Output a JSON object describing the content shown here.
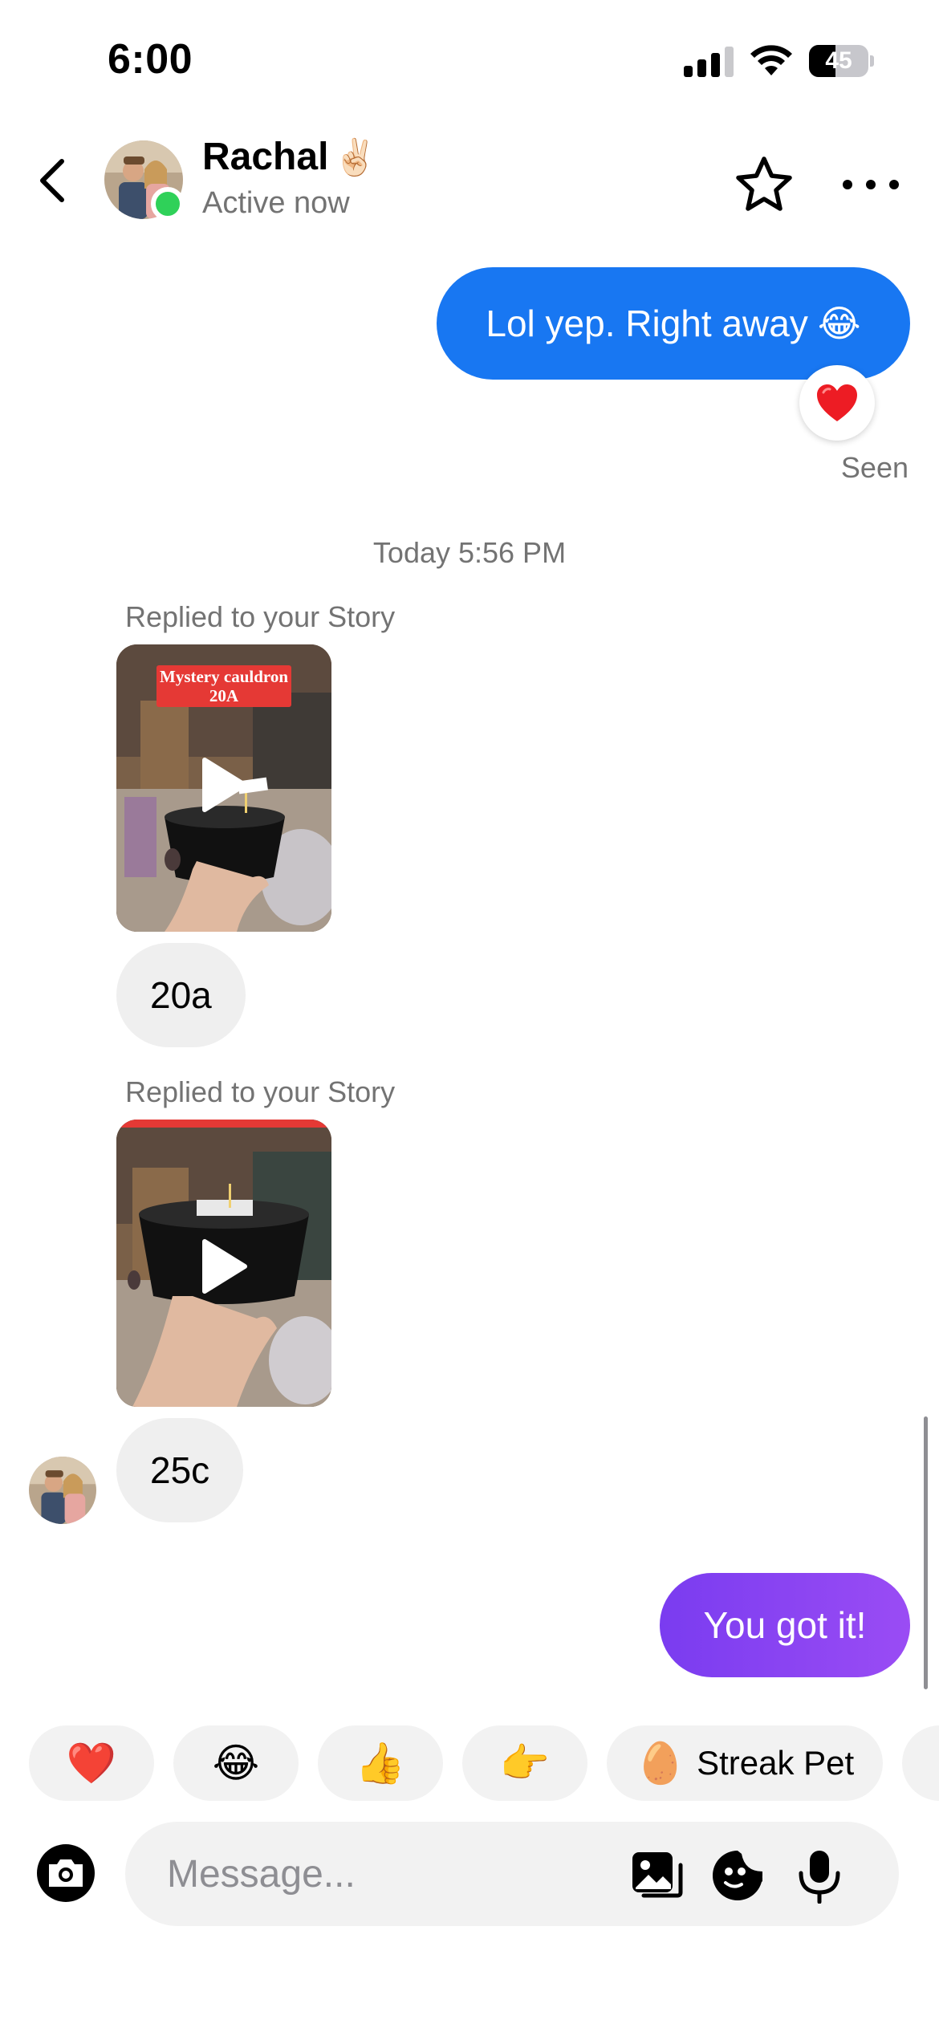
{
  "status_bar": {
    "time": "6:00",
    "battery": "45",
    "battery_fraction": 0.45
  },
  "header": {
    "back_icon": "chevron-left-icon",
    "contact_name": "Rachal",
    "contact_name_emoji": "✌🏻",
    "contact_status": "Active now",
    "star_icon": "star-outline-icon",
    "more_icon": "more-horizontal-icon"
  },
  "messages": {
    "outgoing_1": {
      "text": "Lol yep. Right away",
      "emoji": "😂",
      "reaction": "❤️"
    },
    "seen": "Seen",
    "timestamp": "Today 5:56 PM",
    "story_reply_1": {
      "label": "Replied to your Story",
      "story_caption_line1": "Mystery cauldron",
      "story_caption_line2": "20A",
      "text": "20a"
    },
    "story_reply_2": {
      "label": "Replied to your Story",
      "text": "25c"
    },
    "outgoing_2": {
      "text": "You got it!"
    }
  },
  "quick_replies": [
    {
      "emoji": "❤️",
      "label": ""
    },
    {
      "emoji": "😂",
      "label": ""
    },
    {
      "emoji": "👍",
      "label": ""
    },
    {
      "emoji": "👉",
      "label": ""
    },
    {
      "emoji": "🥚",
      "label": "Streak Pet"
    }
  ],
  "composer": {
    "placeholder": "Message...",
    "icons": [
      "camera-icon",
      "gallery-icon",
      "sticker-icon",
      "microphone-icon"
    ]
  },
  "colors": {
    "outgoing_blue": "#1877f2",
    "outgoing_purple": "#8a45f2",
    "online_green": "#2fd159",
    "incoming_gray": "#efefef"
  }
}
